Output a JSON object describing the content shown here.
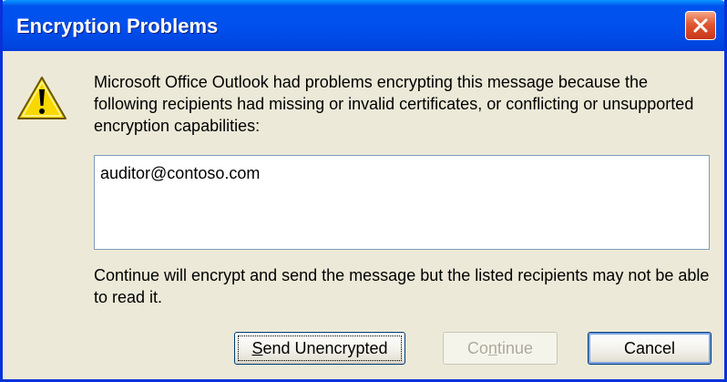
{
  "window": {
    "title": "Encryption Problems"
  },
  "icons": {
    "warning": "warning-icon",
    "close": "close-icon"
  },
  "message": "Microsoft Office Outlook had problems encrypting this message because the following recipients had missing or invalid certificates, or conflicting or unsupported encryption capabilities:",
  "recipients": [
    "auditor@contoso.com"
  ],
  "note": "Continue will encrypt and send the message but the listed recipients may not be able to read it.",
  "buttons": {
    "send_unencrypted": {
      "label": "Send Unencrypted",
      "accesskey_char": "S",
      "label_rest": "end Unencrypted",
      "enabled": true
    },
    "continue": {
      "label": "Continue",
      "label_pre": "Co",
      "accesskey_char": "n",
      "label_rest": "tinue",
      "enabled": false
    },
    "cancel": {
      "label": "Cancel",
      "enabled": true,
      "default": true
    }
  },
  "colors": {
    "title_bar": "#0050ee",
    "dialog_bg": "#ece9d8",
    "close_button": "#e0572f",
    "warning_yellow": "#f8d800"
  }
}
